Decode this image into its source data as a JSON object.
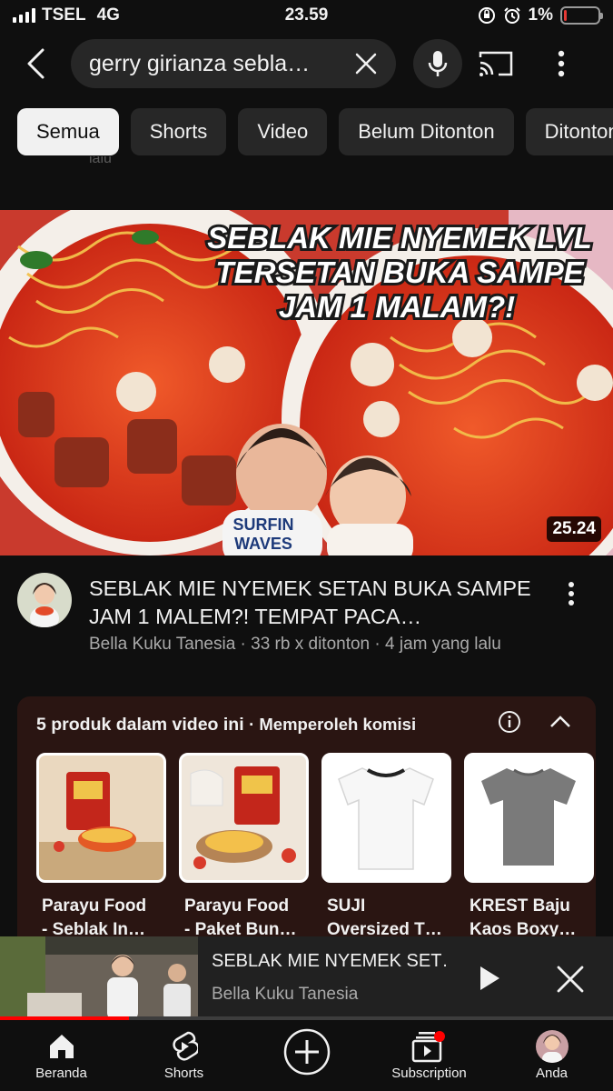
{
  "status_bar": {
    "carrier": "TSEL",
    "network": "4G",
    "time": "23.59",
    "battery": "1%",
    "battery_level": 0.01,
    "battery_color": "#e53935"
  },
  "search": {
    "query": "gerry girianza sebla…",
    "back_icon": "back-arrow-icon",
    "clear_icon": "close-icon",
    "mic_icon": "microphone-icon",
    "cast_icon": "cast-icon",
    "more_icon": "more-vertical-icon"
  },
  "chips": [
    {
      "label": "Semua",
      "active": true
    },
    {
      "label": "Shorts",
      "active": false
    },
    {
      "label": "Video",
      "active": false
    },
    {
      "label": "Belum Ditonton",
      "active": false
    },
    {
      "label": "Ditonton",
      "active": false
    }
  ],
  "cutoff_text": "lalu",
  "video": {
    "thumbnail_text": [
      "SEBLAK MIE NYEMEK LVL",
      "TERSETAN BUKA SAMPE",
      "JAM 1 MALAM?!"
    ],
    "shirt_text": [
      "SURFIN",
      "WAVES"
    ],
    "duration": "25.24",
    "title": "SEBLAK MIE NYEMEK SETAN BUKA SAMPE JAM 1 MALEM?! TEMPAT PACA…",
    "meta": "Bella Kuku Tanesia · 33 rb x ditonton · 4 jam yang lalu"
  },
  "products": {
    "heading": "5 produk dalam video ini",
    "subheading": "· Memperoleh komisi",
    "info_icon": "info-icon",
    "collapse_icon": "chevron-up-icon",
    "items": [
      {
        "name_line1": "Parayu Food",
        "name_line2": "- Seblak In…"
      },
      {
        "name_line1": "Parayu Food",
        "name_line2": "- Paket Bun…"
      },
      {
        "name_line1": "SUJI",
        "name_line2": "Oversized T…"
      },
      {
        "name_line1": "KREST Baju",
        "name_line2": "Kaos Boxy…"
      }
    ]
  },
  "mini_player": {
    "title": "SEBLAK MIE NYEMEK SET…",
    "channel": "Bella Kuku Tanesia",
    "progress": 0.21,
    "play_icon": "play-icon",
    "close_icon": "close-icon"
  },
  "nav": {
    "items": [
      {
        "label": "Beranda",
        "icon": "home-icon"
      },
      {
        "label": "Shorts",
        "icon": "shorts-icon"
      },
      {
        "label": "",
        "icon": "create-plus-icon"
      },
      {
        "label": "Subscription",
        "icon": "subscriptions-icon"
      },
      {
        "label": "Anda",
        "icon": "avatar"
      }
    ],
    "badge_color": "#ff0000"
  },
  "colors": {
    "background": "#0f0f0f",
    "chip_active": "#f1f1f1",
    "chip": "#272727",
    "products_bg": "#2a1512",
    "accent_red": "#ff0000"
  }
}
